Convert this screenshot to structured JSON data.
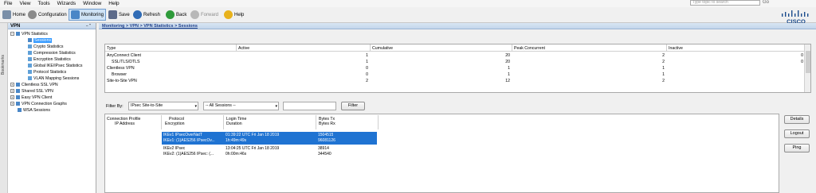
{
  "menu": [
    "File",
    "View",
    "Tools",
    "Wizards",
    "Window",
    "Help"
  ],
  "search": {
    "placeholder": "Type topic to search",
    "go_label": "Go"
  },
  "toolbar": {
    "home": "Home",
    "configuration": "Configuration",
    "monitoring": "Monitoring",
    "save": "Save",
    "refresh": "Refresh",
    "back": "Back",
    "forward": "Forward",
    "help": "Help"
  },
  "brand": "CISCO",
  "left_strip_label": "Bookmarks",
  "nav": {
    "title": "VPN",
    "pin": "− \"",
    "items": [
      {
        "label": "VPN Statistics",
        "expander": "−"
      },
      {
        "label": "Sessions"
      },
      {
        "label": "Crypto Statistics"
      },
      {
        "label": "Compression Statistics"
      },
      {
        "label": "Encryption Statistics"
      },
      {
        "label": "Global IKE/IPsec Statistics"
      },
      {
        "label": "Protocol Statistics"
      },
      {
        "label": "VLAN Mapping Sessions"
      },
      {
        "label": "Clientless SSL VPN",
        "expander": "+"
      },
      {
        "label": "Shared SSL VPN",
        "expander": "+"
      },
      {
        "label": "Easy VPN Client",
        "expander": "+"
      },
      {
        "label": "VPN Connection Graphs",
        "expander": "+"
      },
      {
        "label": "WSA Sessions"
      }
    ]
  },
  "breadcrumb": "Monitoring > VPN > VPN Statistics > Sessions",
  "stats": {
    "columns": [
      "Type",
      "Active",
      "Cumulative",
      "Peak Concurrent",
      "Inactive"
    ],
    "rows": [
      {
        "type": "AnyConnect Client",
        "active": "1",
        "cumulative": "20",
        "peak": "2",
        "inactive": "0"
      },
      {
        "type": "SSL/TLS/DTLS",
        "active": "1",
        "cumulative": "20",
        "peak": "2",
        "inactive": "0"
      },
      {
        "type": "Clientless VPN",
        "active": "0",
        "cumulative": "1",
        "peak": "1",
        "inactive": ""
      },
      {
        "type": "Browser",
        "active": "0",
        "cumulative": "1",
        "peak": "1",
        "inactive": ""
      },
      {
        "type": "Site-to-Site VPN",
        "active": "2",
        "cumulative": "12",
        "peak": "2",
        "inactive": ""
      }
    ]
  },
  "filter": {
    "label": "Filter By:",
    "type_value": "IPsec Site-to-Site",
    "sessions_value": "-- All Sessions --",
    "button": "Filter"
  },
  "sessions": {
    "headers": {
      "profile": "Connection Profile",
      "ip": "IP Address",
      "protocol": "Protocol",
      "encryption": "Encryption",
      "login": "Login Time",
      "duration": "Duration",
      "tx": "Bytes Tx",
      "rx": "Bytes Rx"
    },
    "rows": [
      {
        "protocol": "IKEv1 IPsecOverNatT",
        "encryption": "IKEv1: (1)AES256  IPsecOv...",
        "login": "01:39:22 UTC Fri Jan 18 2019",
        "duration": "1h:49m:49s",
        "tx": "1504515",
        "rx": "96081126"
      },
      {
        "protocol": "IKEv2 IPsec",
        "encryption": "IKEv2: (1)AES256  IPsec: (...",
        "login": "13:04:25 UTC Fri Jan 18 2019",
        "duration": "0h:00m:46s",
        "tx": "38914",
        "rx": "344540"
      }
    ]
  },
  "actions": {
    "details": "Details",
    "logout": "Logout",
    "ping": "Ping"
  }
}
